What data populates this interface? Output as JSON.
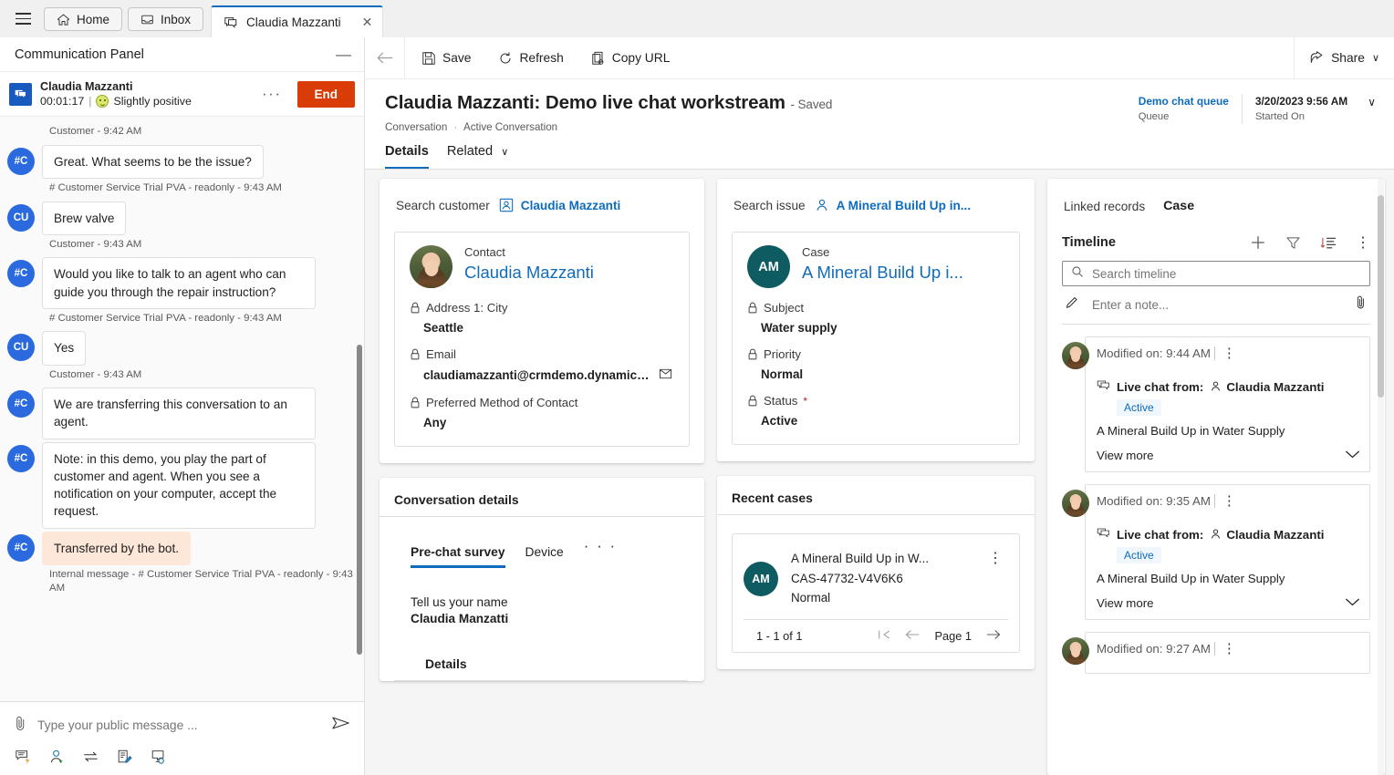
{
  "tabstrip": {
    "menu_label": "menu",
    "tabs": [
      {
        "label": "Home",
        "icon": "home-icon"
      },
      {
        "label": "Inbox",
        "icon": "inbox-icon"
      }
    ],
    "active_tab": {
      "label": "Claudia Mazzanti",
      "icon": "chat-icon",
      "close": "✕"
    }
  },
  "comm_panel": {
    "title": "Communication Panel",
    "minimize": "—",
    "conversation": {
      "customer_name": "Claudia Mazzanti",
      "timer": "00:01:17",
      "separator": "|",
      "sentiment": "Slightly positive",
      "more": "···",
      "end_label": "End"
    },
    "messages": [
      {
        "kind": "stamp",
        "text": "Customer - 9:42 AM"
      },
      {
        "kind": "msg",
        "avatar": "#C",
        "text": "Great. What seems to be the issue?"
      },
      {
        "kind": "stamp",
        "text": "# Customer Service Trial PVA - readonly - 9:43 AM"
      },
      {
        "kind": "msg",
        "avatar": "CU",
        "text": "Brew valve"
      },
      {
        "kind": "stamp",
        "text": "Customer - 9:43 AM"
      },
      {
        "kind": "msg",
        "avatar": "#C",
        "text": "Would you like to talk to an agent who can guide you through the repair instruction?"
      },
      {
        "kind": "stamp",
        "text": "# Customer Service Trial PVA - readonly - 9:43 AM"
      },
      {
        "kind": "msg",
        "avatar": "CU",
        "text": "Yes"
      },
      {
        "kind": "stamp",
        "text": "Customer - 9:43 AM"
      },
      {
        "kind": "msg",
        "avatar": "#C",
        "text": "We are transferring this conversation to an agent."
      },
      {
        "kind": "msg",
        "avatar": "#C",
        "text": "Note: in this demo, you play the part of customer and agent. When you see a notification on your computer, accept the request."
      },
      {
        "kind": "msg",
        "avatar": "#C",
        "text": "Transferred by the bot.",
        "internal": true
      },
      {
        "kind": "stamp",
        "text": "Internal message - # Customer Service Trial PVA - readonly - 9:43 AM"
      }
    ],
    "composer": {
      "attach_icon": "paperclip-icon",
      "placeholder": "Type your public message ...",
      "send_icon": "send-icon",
      "tools": [
        "quick-reply-icon",
        "add-agent-icon",
        "transfer-icon",
        "notes-icon",
        "consult-icon"
      ]
    }
  },
  "command_bar": {
    "back": "back-arrow-icon",
    "save": "Save",
    "refresh": "Refresh",
    "copy_url": "Copy URL",
    "share": "Share",
    "share_chevron": "∨"
  },
  "record": {
    "title": "Claudia Mazzanti: Demo live chat workstream",
    "saved_suffix": "- Saved",
    "breadcrumb_entity": "Conversation",
    "breadcrumb_sep": "·",
    "breadcrumb_view": "Active Conversation",
    "header_fields": [
      {
        "value": "Demo chat queue",
        "label": "Queue",
        "link": true
      },
      {
        "value": "3/20/2023 9:56 AM",
        "label": "Started On",
        "link": false
      }
    ],
    "header_chevron": "∨",
    "tabs": [
      {
        "label": "Details",
        "active": true
      },
      {
        "label": "Related",
        "active": false,
        "chevron": "∨"
      }
    ]
  },
  "customer_panel": {
    "search_label": "Search customer",
    "search_value": "Claudia Mazzanti",
    "entity_type": "Contact",
    "entity_name": "Claudia Mazzanti",
    "fields": [
      {
        "label": "Address 1: City",
        "value": "Seattle"
      },
      {
        "label": "Email",
        "value": "claudiamazzanti@crmdemo.dynamics....",
        "has_mail_icon": true
      },
      {
        "label": "Preferred Method of Contact",
        "value": "Any"
      }
    ]
  },
  "issue_panel": {
    "search_label": "Search issue",
    "search_value": "A Mineral Build Up in...",
    "initials": "AM",
    "entity_type": "Case",
    "entity_name": "A Mineral Build Up i...",
    "fields": [
      {
        "label": "Subject",
        "value": "Water supply"
      },
      {
        "label": "Priority",
        "value": "Normal"
      },
      {
        "label": "Status",
        "value": "Active",
        "required": true
      }
    ]
  },
  "conversation_details": {
    "heading": "Conversation details",
    "tabs": [
      {
        "label": "Pre-chat survey",
        "active": true
      },
      {
        "label": "Device",
        "active": false
      }
    ],
    "more": "· · ·",
    "question": "Tell us your name",
    "answer": "Claudia Manzatti",
    "details_heading": "Details"
  },
  "recent_cases": {
    "heading": "Recent cases",
    "items": [
      {
        "initials": "AM",
        "title": "A Mineral Build Up in W...",
        "number": "CAS-47732-V4V6K6",
        "priority": "Normal"
      }
    ],
    "count": "1 - 1 of 1",
    "first_page": "first-page-icon",
    "prev_page": "prev-page-icon",
    "page_label": "Page 1",
    "next_page": "next-page-icon"
  },
  "timeline_panel": {
    "linked_label": "Linked records",
    "linked_value": "Case",
    "heading": "Timeline",
    "actions": [
      "add-icon",
      "filter-icon",
      "sort-icon",
      "more-icon"
    ],
    "search_placeholder": "Search timeline",
    "note_placeholder": "Enter a note...",
    "note_attach_icon": "paperclip-icon",
    "items": [
      {
        "modified": "Modified on: 9:44 AM",
        "kebab": "⋮",
        "chat_label": "Live chat from:",
        "who": "Claudia Mazzanti",
        "status": "Active",
        "subject": "A Mineral Build Up in Water Supply",
        "view_more": "View more"
      },
      {
        "modified": "Modified on: 9:35 AM",
        "kebab": "⋮",
        "chat_label": "Live chat from:",
        "who": "Claudia Mazzanti",
        "status": "Active",
        "subject": "A Mineral Build Up in Water Supply",
        "view_more": "View more"
      },
      {
        "modified": "Modified on: 9:27 AM",
        "kebab": "⋮",
        "chat_label": "",
        "who": "",
        "status": "",
        "subject": "",
        "view_more": ""
      }
    ]
  },
  "colors": {
    "accent": "#0f6cbd",
    "end_button": "#d93c06",
    "case_circle": "#0e5c61",
    "avatar_blue": "#2a6ade",
    "internal_message": "#fde7d9",
    "badge_bg": "#eff6fc"
  }
}
